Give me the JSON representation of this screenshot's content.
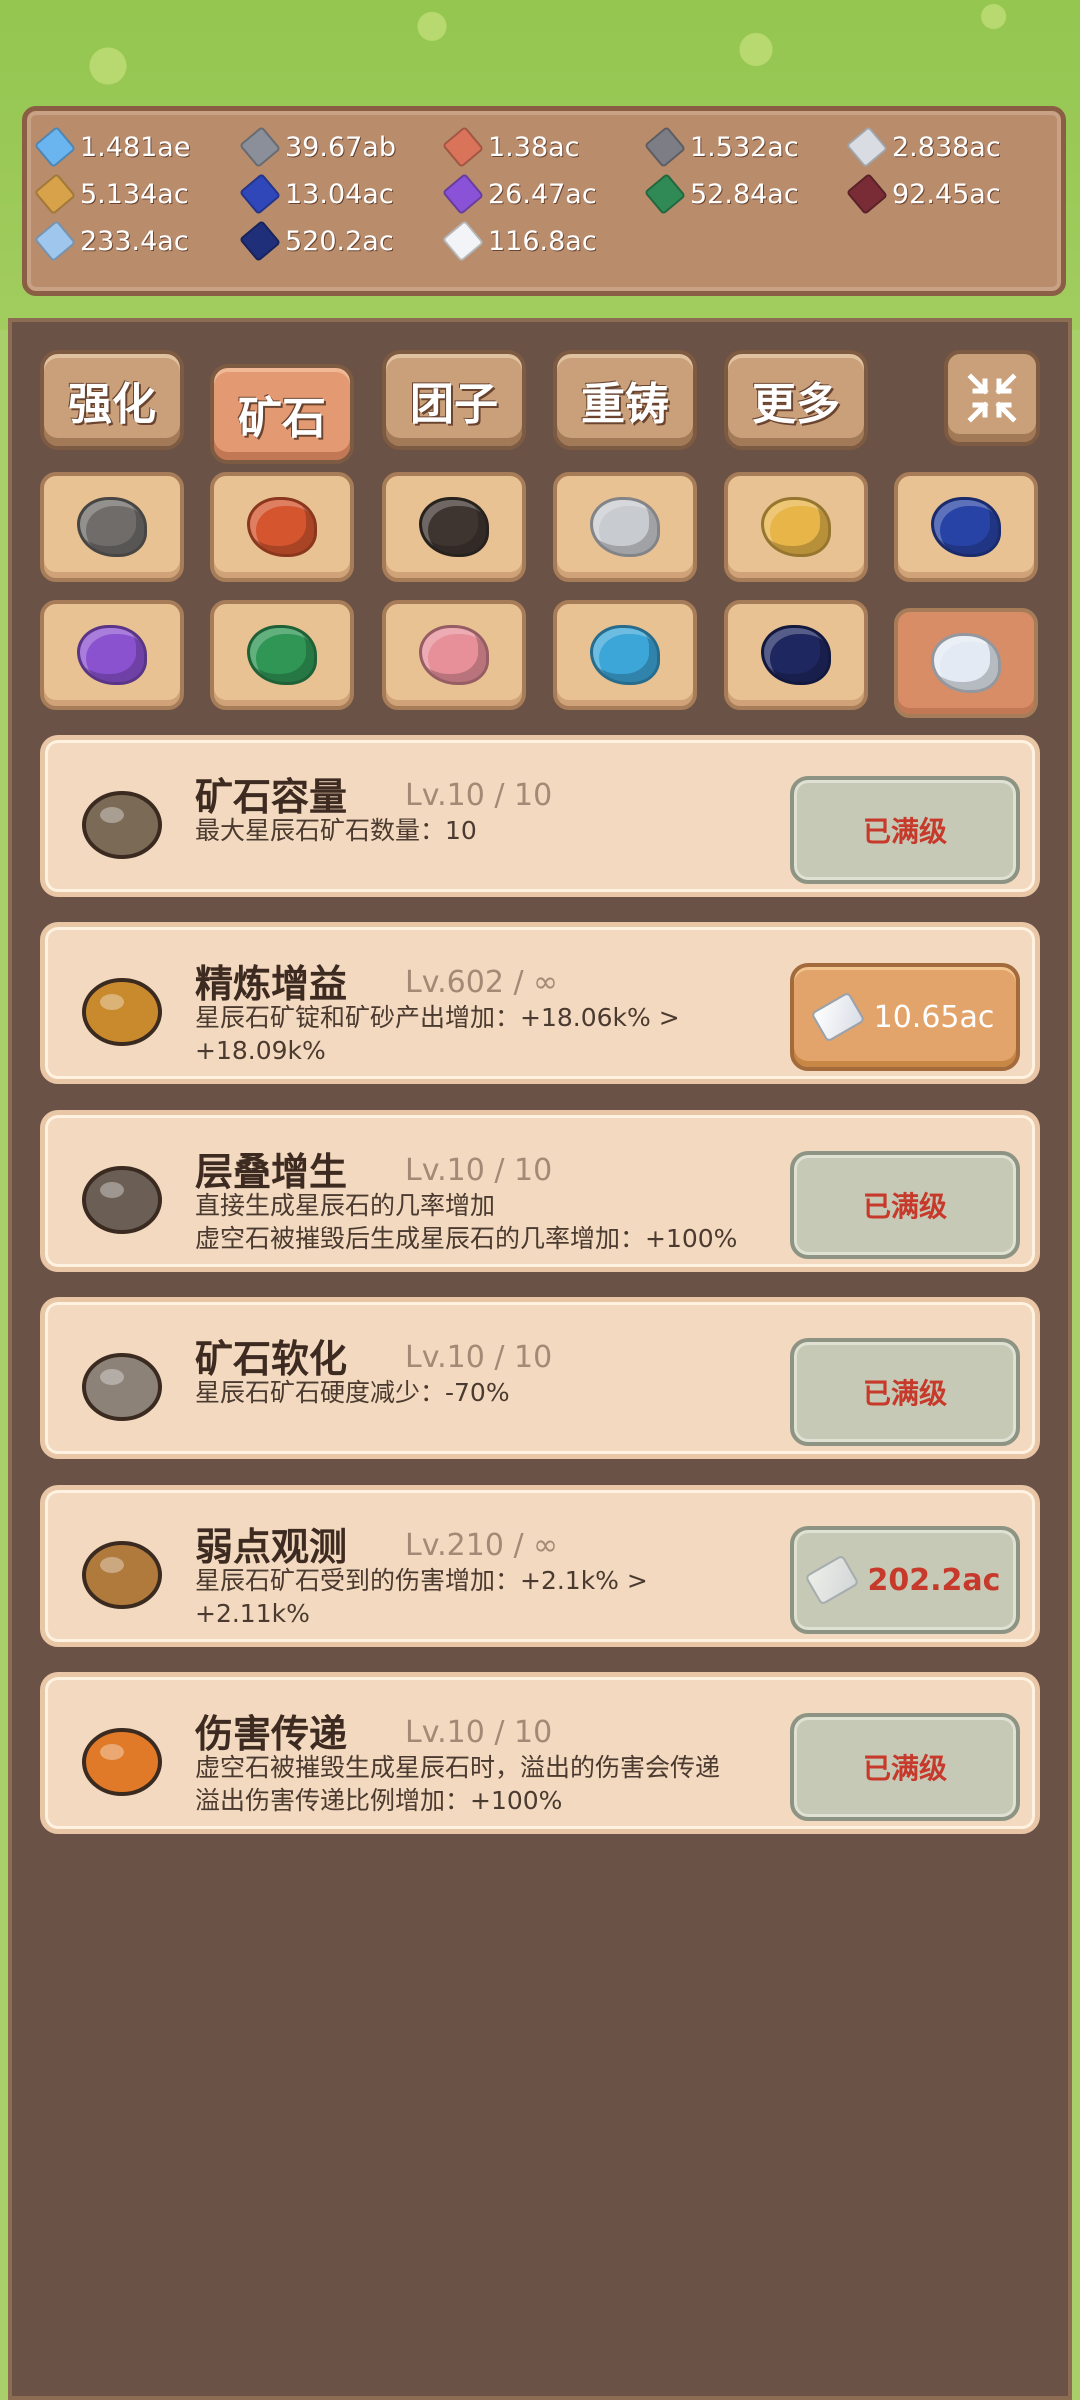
{
  "resources": [
    {
      "value": "1.481ae",
      "color": "#6ab4f0"
    },
    {
      "value": "39.67ab",
      "color": "#8a8f99"
    },
    {
      "value": "1.38ac",
      "color": "#d9735a"
    },
    {
      "value": "1.532ac",
      "color": "#7d7d85"
    },
    {
      "value": "2.838ac",
      "color": "#d9dde3"
    },
    {
      "value": "5.134ac",
      "color": "#d8a24a"
    },
    {
      "value": "13.04ac",
      "color": "#2f47b8"
    },
    {
      "value": "26.47ac",
      "color": "#8a52d6"
    },
    {
      "value": "52.84ac",
      "color": "#2f8a55"
    },
    {
      "value": "92.45ac",
      "color": "#7a2c36"
    },
    {
      "value": "233.4ac",
      "color": "#9fc6ec"
    },
    {
      "value": "520.2ac",
      "color": "#1f2f7a"
    },
    {
      "value": "116.8ac",
      "color": "#f2f4f7"
    }
  ],
  "tabs": [
    "强化",
    "矿石",
    "团子",
    "重铸",
    "更多"
  ],
  "active_tab": "矿石",
  "shrink_icon": "collapse-icon",
  "ores": [
    {
      "name": "gray-stone",
      "color": "#6f6c69"
    },
    {
      "name": "red-ore",
      "color": "#d4552e"
    },
    {
      "name": "dark-ore",
      "color": "#3e3530"
    },
    {
      "name": "silver-ore",
      "color": "#c8cbd0"
    },
    {
      "name": "gold-ore",
      "color": "#e7b548"
    },
    {
      "name": "lapis-ore",
      "color": "#2843a6"
    },
    {
      "name": "amethyst-ore",
      "color": "#8b52d0"
    },
    {
      "name": "emerald-ore",
      "color": "#2f9655"
    },
    {
      "name": "rose-ore",
      "color": "#e7909a"
    },
    {
      "name": "aqua-ore",
      "color": "#3da6d8"
    },
    {
      "name": "night-ore",
      "color": "#1e2760"
    },
    {
      "name": "star-ore",
      "color": "#e4eaf3"
    }
  ],
  "upgrades": [
    {
      "title": "矿石容量",
      "level": "Lv.10 / 10",
      "desc1": "最大星辰石矿石数量：10",
      "desc2": "",
      "button": "已满级",
      "btn_type": "maxed",
      "icon": "ore-cluster-icon"
    },
    {
      "title": "精炼增益",
      "level": "Lv.602 / ∞",
      "desc1": "星辰石矿锭和矿砂产出增加：+18.06k% >",
      "desc2": "+18.09k%",
      "button": "10.65ac",
      "btn_type": "buy",
      "icon": "furnace-icon"
    },
    {
      "title": "层叠增生",
      "level": "Lv.10 / 10",
      "desc1": "直接生成星辰石的几率增加",
      "desc2": "虚空石被摧毁后生成星辰石的几率增加：+100%",
      "button": "已满级",
      "btn_type": "maxed",
      "icon": "layered-rock-icon"
    },
    {
      "title": "矿石软化",
      "level": "Lv.10 / 10",
      "desc1": "星辰石矿石硬度减少：-70%",
      "desc2": "",
      "button": "已满级",
      "btn_type": "maxed",
      "icon": "soft-rock-icon"
    },
    {
      "title": "弱点观测",
      "level": "Lv.210 / ∞",
      "desc1": "星辰石矿石受到的伤害增加：+2.1k% >",
      "desc2": "+2.11k%",
      "button": "202.2ac",
      "btn_type": "gray",
      "icon": "magnifier-icon"
    },
    {
      "title": "伤害传递",
      "level": "Lv.10 / 10",
      "desc1": "虚空石被摧毁生成星辰石时，溢出的伤害会传递",
      "desc2": "溢出伤害传递比例增加：+100%",
      "button": "已满级",
      "btn_type": "maxed",
      "icon": "explosion-rock-icon"
    }
  ]
}
